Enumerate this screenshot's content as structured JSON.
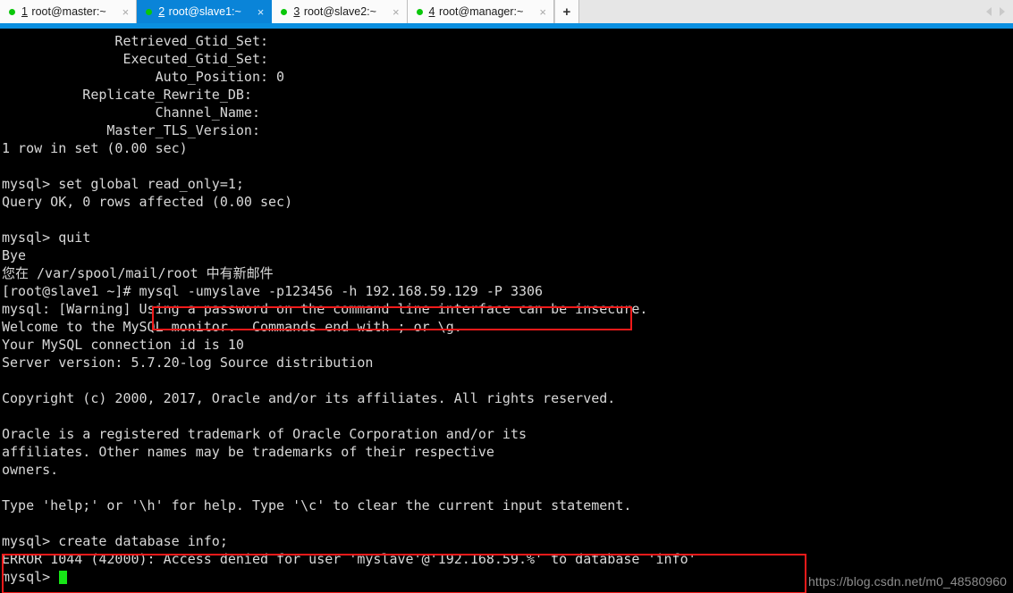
{
  "tabbar": {
    "tabs": [
      {
        "index": "1",
        "title": " root@master:~",
        "close_label": "×",
        "status": "running",
        "active": false
      },
      {
        "index": "2",
        "title": " root@slave1:~",
        "close_label": "×",
        "status": "running",
        "active": true
      },
      {
        "index": "3",
        "title": " root@slave2:~",
        "close_label": "×",
        "status": "running",
        "active": false
      },
      {
        "index": "4",
        "title": " root@manager:~",
        "close_label": "×",
        "status": "running",
        "active": false
      }
    ],
    "new_tab_label": "+",
    "scroll_left_icon": "chevron-left-icon",
    "scroll_right_icon": "chevron-right-icon",
    "accent_color": "#0a84d8",
    "status_dot_color": "#0ac70a"
  },
  "terminal": {
    "foreground_color": "#d8d8d8",
    "background_color": "#000000",
    "cursor_color": "#17e617",
    "lines": [
      "              Retrieved_Gtid_Set: ",
      "               Executed_Gtid_Set: ",
      "                   Auto_Position: 0",
      "          Replicate_Rewrite_DB: ",
      "                   Channel_Name: ",
      "             Master_TLS_Version: ",
      "1 row in set (0.00 sec)",
      "",
      "mysql> set global read_only=1;",
      "Query OK, 0 rows affected (0.00 sec)",
      "",
      "mysql> quit",
      "Bye",
      "您在 /var/spool/mail/root 中有新邮件",
      "[root@slave1 ~]# mysql -umyslave -p123456 -h 192.168.59.129 -P 3306",
      "mysql: [Warning] Using a password on the command line interface can be insecure.",
      "Welcome to the MySQL monitor.  Commands end with ; or \\g.",
      "Your MySQL connection id is 10",
      "Server version: 5.7.20-log Source distribution",
      "",
      "Copyright (c) 2000, 2017, Oracle and/or its affiliates. All rights reserved.",
      "",
      "Oracle is a registered trademark of Oracle Corporation and/or its",
      "affiliates. Other names may be trademarks of their respective",
      "owners.",
      "",
      "Type 'help;' or '\\h' for help. Type '\\c' to clear the current input statement.",
      "",
      "mysql> create database info;",
      "ERROR 1044 (42000): Access denied for user 'myslave'@'192.168.59.%' to database 'info'"
    ],
    "prompt_last": "mysql> "
  },
  "annotations": {
    "box_color": "#f01a1a",
    "box_command_label": "mysql -umyslave -p123456 -h 192.168.59.129 -P 3306",
    "box_error_label": "ERROR 1044 (42000): Access denied for user 'myslave'@'192.168.59.%' to database 'info'"
  },
  "watermark": {
    "text": "https://blog.csdn.net/m0_48580960"
  }
}
